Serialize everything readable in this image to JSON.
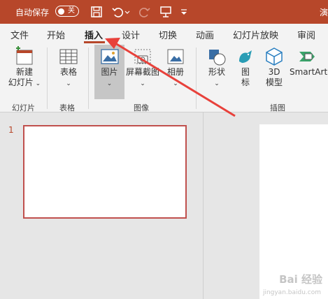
{
  "titlebar": {
    "autosave_label": "自动保存",
    "toggle_label": "关",
    "title_fragment": "演"
  },
  "tabs": [
    {
      "label": "文件"
    },
    {
      "label": "开始"
    },
    {
      "label": "插入"
    },
    {
      "label": "设计"
    },
    {
      "label": "切换"
    },
    {
      "label": "动画"
    },
    {
      "label": "幻灯片放映"
    },
    {
      "label": "审阅"
    }
  ],
  "ribbon": {
    "new_slide": {
      "line1": "新建",
      "line2": "幻灯片"
    },
    "table": {
      "label": "表格"
    },
    "picture": {
      "label": "图片"
    },
    "screenshot": {
      "label": "屏幕截图"
    },
    "album": {
      "label": "相册"
    },
    "shapes": {
      "label": "形状"
    },
    "icons": {
      "line1": "图",
      "line2": "标"
    },
    "model3d": {
      "line1": "3D",
      "line2": "模型"
    },
    "smartart": {
      "label": "SmartArt"
    },
    "groups": {
      "slides": "幻灯片",
      "tables": "表格",
      "images": "图像",
      "illustrations": "插图"
    }
  },
  "thumbs": {
    "slide_number": "1"
  },
  "watermark": {
    "brand": "Bai 经验",
    "sub": "jingyan.baidu.com"
  },
  "colors": {
    "accent": "#b7472a",
    "arrow": "#e8413b"
  }
}
